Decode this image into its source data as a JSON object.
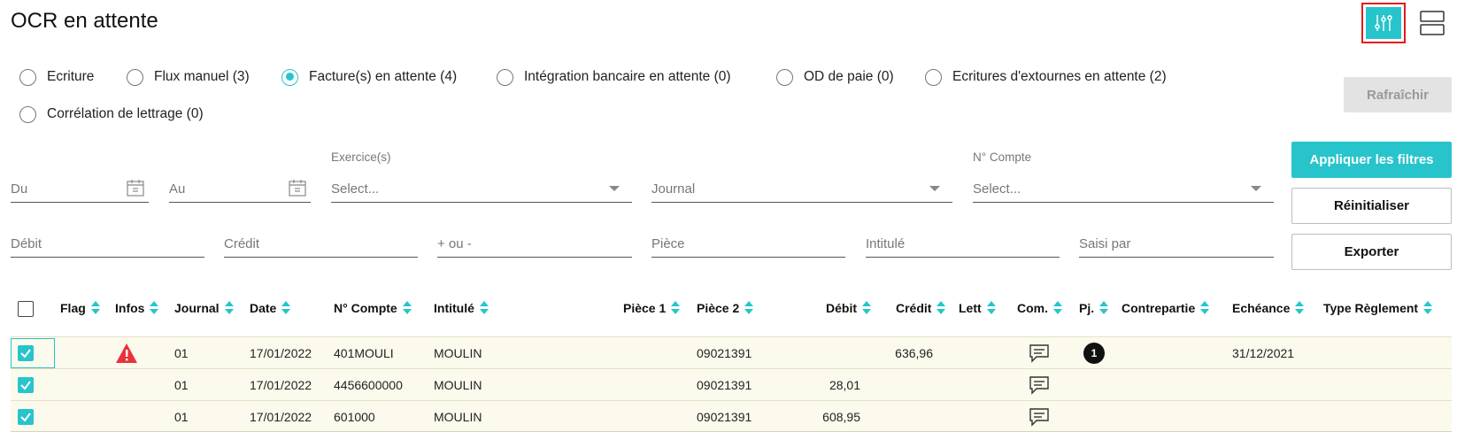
{
  "page": {
    "title": "OCR en attente"
  },
  "header": {
    "filters_toggle_icon": "sliders-icon",
    "layout_icon": "split-view-icon"
  },
  "modes": [
    {
      "label": "Ecriture",
      "checked": false
    },
    {
      "label": "Flux manuel (3)",
      "checked": false
    },
    {
      "label": "Facture(s) en attente (4)",
      "checked": true
    },
    {
      "label": "Intégration bancaire en attente (0)",
      "checked": false
    },
    {
      "label": "OD de paie (0)",
      "checked": false
    },
    {
      "label": "Ecritures d'extournes en attente (2)",
      "checked": false
    },
    {
      "label": "Corrélation de lettrage (0)",
      "checked": false
    }
  ],
  "buttons": {
    "refresh": "Rafraîchir",
    "apply": "Appliquer les filtres",
    "reset": "Réinitialiser",
    "export": "Exporter"
  },
  "filters": {
    "du": {
      "placeholder": "Du"
    },
    "au": {
      "placeholder": "Au"
    },
    "exercice": {
      "label": "Exercice(s)",
      "value": "Select..."
    },
    "journal": {
      "value": "Journal"
    },
    "compte": {
      "label": "N° Compte",
      "value": "Select..."
    },
    "debit": {
      "placeholder": "Débit"
    },
    "credit": {
      "placeholder": "Crédit"
    },
    "plusminus": {
      "placeholder": "+ ou -"
    },
    "piece": {
      "placeholder": "Pièce"
    },
    "intitule": {
      "placeholder": "Intitulé"
    },
    "saisi_par": {
      "placeholder": "Saisi par"
    }
  },
  "table": {
    "columns": [
      "Flag",
      "Infos",
      "Journal",
      "Date",
      "N° Compte",
      "Intitulé",
      "Pièce 1",
      "Pièce 2",
      "Débit",
      "Crédit",
      "Lett",
      "Com.",
      "Pj.",
      "Contrepartie",
      "Echéance",
      "Type Règlement"
    ],
    "rows": [
      {
        "checked": true,
        "warning": true,
        "journal": "01",
        "date": "17/01/2022",
        "compte": "401MOULI",
        "intitule": "MOULIN",
        "piece1": "",
        "piece2": "09021391",
        "debit": "",
        "credit": "636,96",
        "comment_icon": "comment-icon",
        "pj": "1",
        "echeance": "31/12/2021"
      },
      {
        "checked": true,
        "warning": false,
        "journal": "01",
        "date": "17/01/2022",
        "compte": "4456600000",
        "intitule": "MOULIN",
        "piece1": "",
        "piece2": "09021391",
        "debit": "28,01",
        "credit": "",
        "comment_icon": "comment-icon",
        "pj": "",
        "echeance": ""
      },
      {
        "checked": true,
        "warning": false,
        "journal": "01",
        "date": "17/01/2022",
        "compte": "601000",
        "intitule": "MOULIN",
        "piece1": "",
        "piece2": "09021391",
        "debit": "608,95",
        "credit": "",
        "comment_icon": "comment-icon",
        "pj": "",
        "echeance": ""
      }
    ]
  },
  "colors": {
    "accent": "#27c4cc",
    "warning": "#e8323c",
    "row_bg": "#fcfaec",
    "highlight": "#e21c1c"
  }
}
